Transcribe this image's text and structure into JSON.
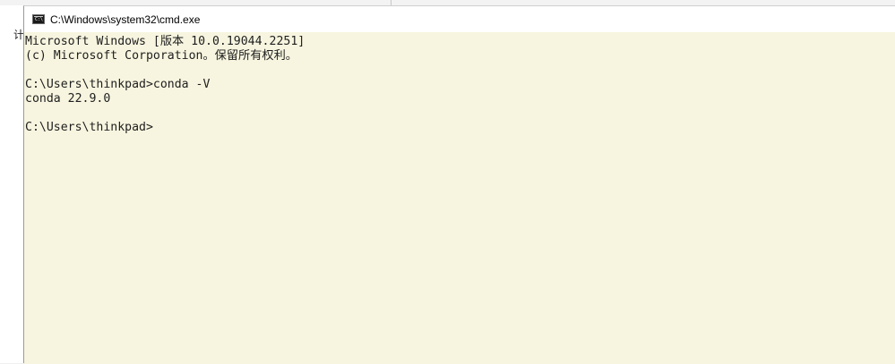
{
  "background_window": {
    "partial_text": "计"
  },
  "window": {
    "title": "C:\\Windows\\system32\\cmd.exe",
    "icon": "cmd-icon",
    "icon_glyph": "C:\\",
    "background_color": "#f7f5df"
  },
  "console": {
    "lines": [
      "Microsoft Windows [版本 10.0.19044.2251]",
      "(c) Microsoft Corporation。保留所有权利。",
      "",
      "C:\\Users\\thinkpad>conda -V",
      "conda 22.9.0",
      "",
      "C:\\Users\\thinkpad>"
    ]
  }
}
